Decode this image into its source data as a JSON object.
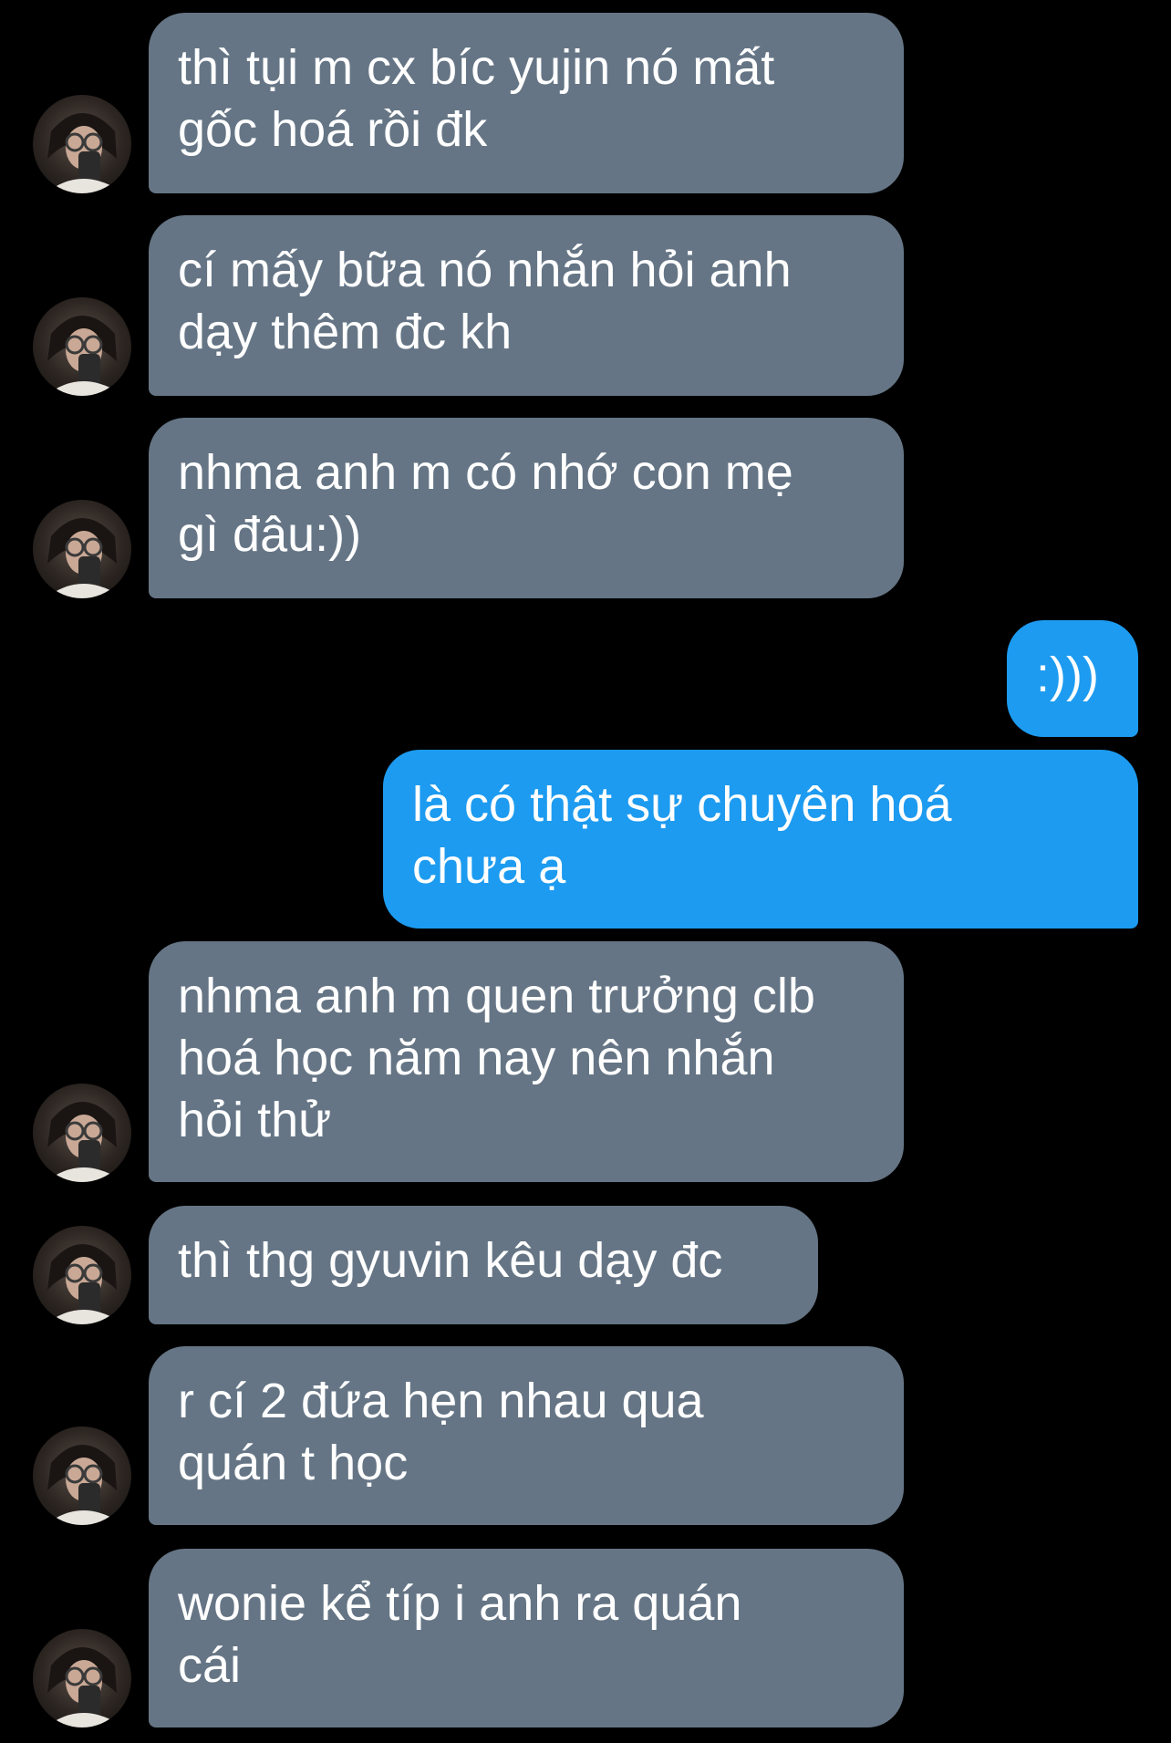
{
  "contact": {
    "avatar_icon": "user-avatar-photo"
  },
  "colors": {
    "background": "#000000",
    "incoming_bubble": "#657585",
    "outgoing_bubble": "#1d9bf0",
    "text": "#ffffff"
  },
  "messages": [
    {
      "direction": "incoming",
      "lines": [
        "thì tụi m cx bíc yujin nó mất",
        "gốc hoá rồi đk"
      ]
    },
    {
      "direction": "incoming",
      "lines": [
        "cí mấy bữa nó nhắn hỏi anh",
        "dạy thêm đc kh"
      ]
    },
    {
      "direction": "incoming",
      "lines": [
        "nhma anh m có nhớ con mẹ",
        "gì đâu:))"
      ]
    },
    {
      "direction": "outgoing",
      "lines": [
        ":)))"
      ]
    },
    {
      "direction": "outgoing",
      "lines": [
        "là có thật sự chuyên hoá",
        "chưa ạ"
      ]
    },
    {
      "direction": "incoming",
      "lines": [
        "nhma anh m quen trưởng clb",
        "hoá học năm nay nên nhắn",
        "hỏi thử"
      ]
    },
    {
      "direction": "incoming",
      "lines": [
        "thì thg gyuvin kêu dạy đc"
      ]
    },
    {
      "direction": "incoming",
      "lines": [
        "r cí 2 đứa hẹn nhau qua",
        "quán t học"
      ]
    },
    {
      "direction": "incoming",
      "lines": [
        "wonie kể típ i anh ra quán",
        "cái"
      ]
    }
  ]
}
